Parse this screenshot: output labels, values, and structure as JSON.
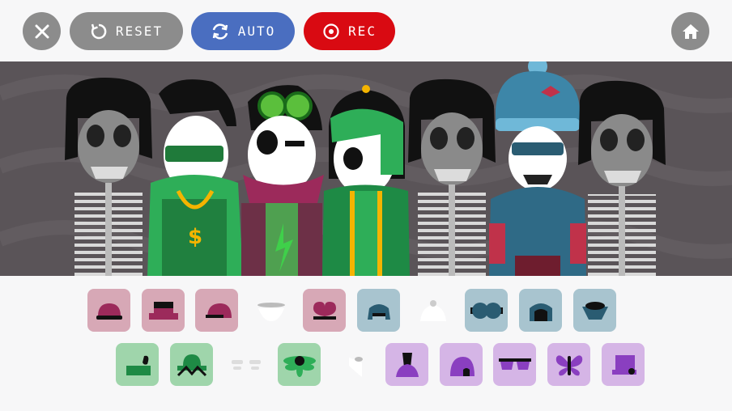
{
  "toolbar": {
    "reset_label": "RESET",
    "auto_label": "AUTO",
    "rec_label": "REC",
    "close_icon": "close-icon",
    "home_icon": "home-icon",
    "colors": {
      "reset": "#8c8c8c",
      "auto": "#4a6ec0",
      "rec": "#d90a12",
      "round": "#8c8c8c"
    }
  },
  "stage": {
    "characters": [
      "grey-skeleton",
      "green-gold-rapper",
      "maroon-scarf-goggles",
      "green-hood-singer",
      "grey-skeleton",
      "blue-beanie-hoodie",
      "grey-skeleton"
    ]
  },
  "palette": {
    "row1": [
      {
        "name": "maroon-cap-icon",
        "color": "#d7a8b6",
        "active": true
      },
      {
        "name": "maroon-box-hat-icon",
        "color": "#d7a8b6",
        "active": true
      },
      {
        "name": "maroon-helmet-icon",
        "color": "#d7a8b6",
        "active": true
      },
      {
        "name": "white-bowl-icon",
        "color": "transparent",
        "active": false
      },
      {
        "name": "maroon-heart-icon",
        "color": "#d7a8b6",
        "active": true
      },
      {
        "name": "teal-helmet-icon",
        "color": "#a8c4cf",
        "active": true
      },
      {
        "name": "white-dome-icon",
        "color": "transparent",
        "active": false
      },
      {
        "name": "teal-goggles-icon",
        "color": "#a8c4cf",
        "active": true
      },
      {
        "name": "teal-hair-icon",
        "color": "#a8c4cf",
        "active": true
      },
      {
        "name": "teal-bowl-icon",
        "color": "#a8c4cf",
        "active": true
      }
    ],
    "row2": [
      {
        "name": "green-feather-icon",
        "color": "#9fd5ab",
        "active": true
      },
      {
        "name": "green-hat-icon",
        "color": "#9fd5ab",
        "active": true
      },
      {
        "name": "white-glasses-icon",
        "color": "transparent",
        "active": false
      },
      {
        "name": "green-flower-icon",
        "color": "#9fd5ab",
        "active": true
      },
      {
        "name": "white-drop-icon",
        "color": "transparent",
        "active": false
      },
      {
        "name": "purple-tophat-icon",
        "color": "#d5b5e6",
        "active": true
      },
      {
        "name": "purple-arch-icon",
        "color": "#d5b5e6",
        "active": true
      },
      {
        "name": "purple-shades-icon",
        "color": "#d5b5e6",
        "active": true
      },
      {
        "name": "purple-butterfly-icon",
        "color": "#d5b5e6",
        "active": true
      },
      {
        "name": "purple-box-icon",
        "color": "#d5b5e6",
        "active": true
      }
    ]
  }
}
